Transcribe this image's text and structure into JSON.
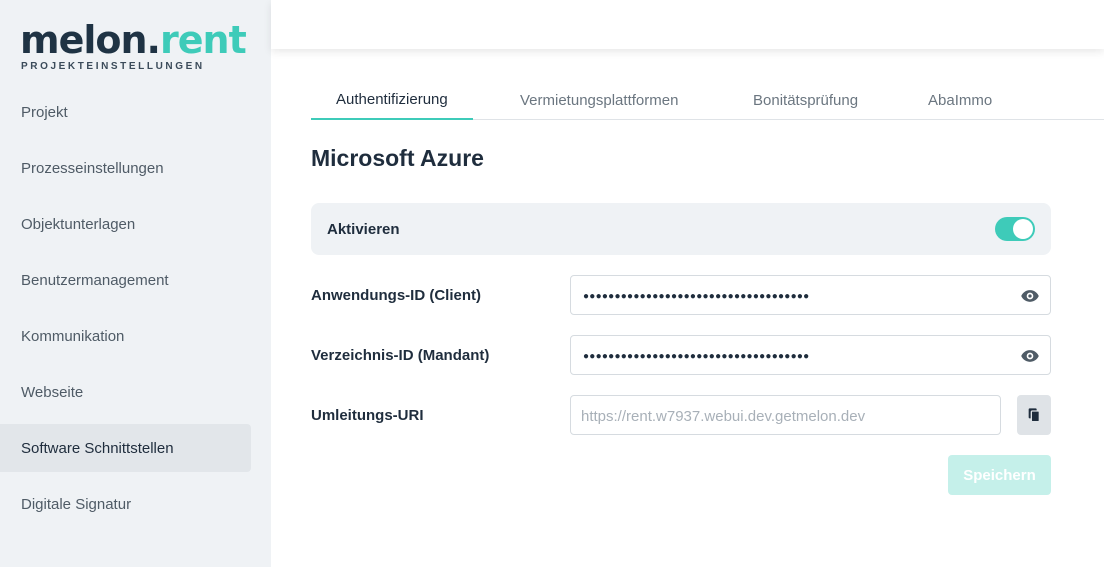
{
  "brand": {
    "name_part1": "melon.",
    "name_part2": "rent",
    "subtitle": "PROJEKTEINSTELLUNGEN"
  },
  "sidebar": {
    "items": [
      {
        "label": "Projekt"
      },
      {
        "label": "Prozesseinstellungen"
      },
      {
        "label": "Objektunterlagen"
      },
      {
        "label": "Benutzermanagement"
      },
      {
        "label": "Kommunikation"
      },
      {
        "label": "Webseite"
      },
      {
        "label": "Software Schnittstellen",
        "active": true
      },
      {
        "label": "Digitale Signatur"
      }
    ]
  },
  "tabs": [
    {
      "label": "Authentifizierung",
      "active": true
    },
    {
      "label": "Vermietungsplattformen"
    },
    {
      "label": "Bonitätsprüfung"
    },
    {
      "label": "AbaImmo"
    }
  ],
  "main": {
    "title": "Microsoft Azure",
    "activate": {
      "label": "Aktivieren",
      "enabled": true
    },
    "fields": {
      "client_id": {
        "label": "Anwendungs-ID (Client)",
        "masked_value": "●●●●●●●●●●●●●●●●●●●●●●●●●●●●●●●●●●●●"
      },
      "tenant_id": {
        "label": "Verzeichnis-ID (Mandant)",
        "masked_value": "●●●●●●●●●●●●●●●●●●●●●●●●●●●●●●●●●●●●"
      },
      "redirect_uri": {
        "label": "Umleitungs-URI",
        "placeholder": "https://rent.w7937.webui.dev.getmelon.dev"
      }
    },
    "save_label": "Speichern"
  },
  "colors": {
    "accent": "#3ecbb9",
    "brand_dark": "#1f3344",
    "sidebar_bg": "#eff2f5",
    "save_disabled": "#c5f0ea"
  },
  "icons": {
    "eye": "eye-icon",
    "copy": "copy-icon"
  }
}
